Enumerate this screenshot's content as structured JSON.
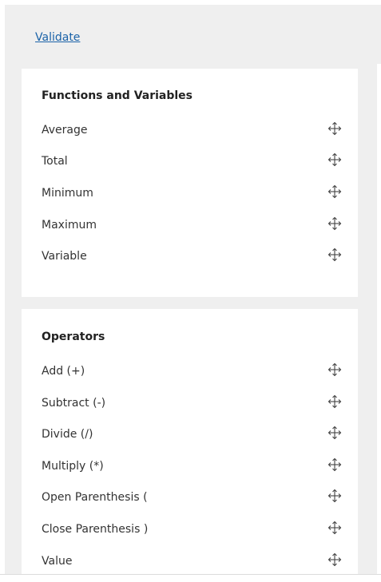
{
  "header": {
    "validate_label": "Validate"
  },
  "functions_panel": {
    "title": "Functions and Variables",
    "items": [
      {
        "label": "Average"
      },
      {
        "label": "Total"
      },
      {
        "label": "Minimum"
      },
      {
        "label": "Maximum"
      },
      {
        "label": "Variable"
      }
    ]
  },
  "operators_panel": {
    "title": "Operators",
    "items": [
      {
        "label": "Add (+)"
      },
      {
        "label": "Subtract (-)"
      },
      {
        "label": "Divide (/)"
      },
      {
        "label": "Multiply (*)"
      },
      {
        "label": "Open Parenthesis ("
      },
      {
        "label": "Close Parenthesis )"
      },
      {
        "label": "Value"
      }
    ]
  },
  "icons": {
    "drag_handle": "move-arrows-icon"
  },
  "colors": {
    "background": "#efefef",
    "panel": "#ffffff",
    "link": "#1a62a8",
    "text": "#333333",
    "heading": "#222222"
  }
}
